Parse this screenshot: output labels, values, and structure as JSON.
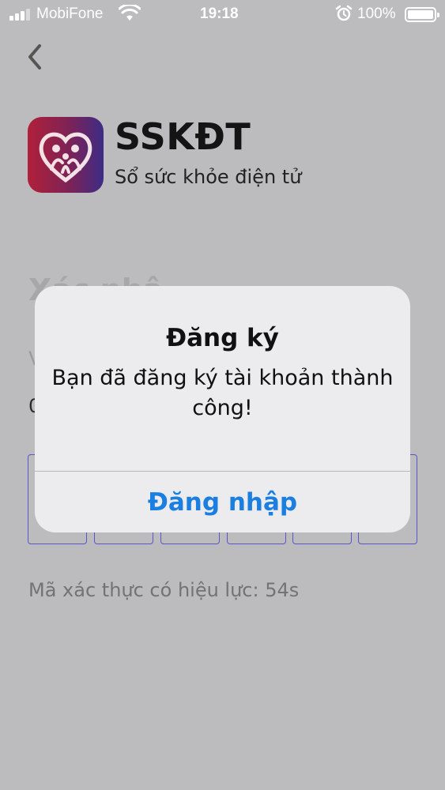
{
  "status_bar": {
    "carrier": "MobiFone",
    "time": "19:18",
    "battery": "100%"
  },
  "app": {
    "name": "SSKĐT",
    "tagline": "Sổ sức khỏe điện tử"
  },
  "background": {
    "title_partial": "Xác nhậ",
    "line1_partial": "V",
    "line2_partial": "0",
    "timer": "Mã xác thực có hiệu lực: 54s",
    "otp_count": 6
  },
  "alert": {
    "title": "Đăng ký",
    "message": "Bạn đã đăng ký tài khoản thành công!",
    "button": "Đăng nhập"
  },
  "colors": {
    "accent": "#1a7fe0",
    "otp_border": "#5a55c8",
    "overlay": "#bcbcbe"
  }
}
